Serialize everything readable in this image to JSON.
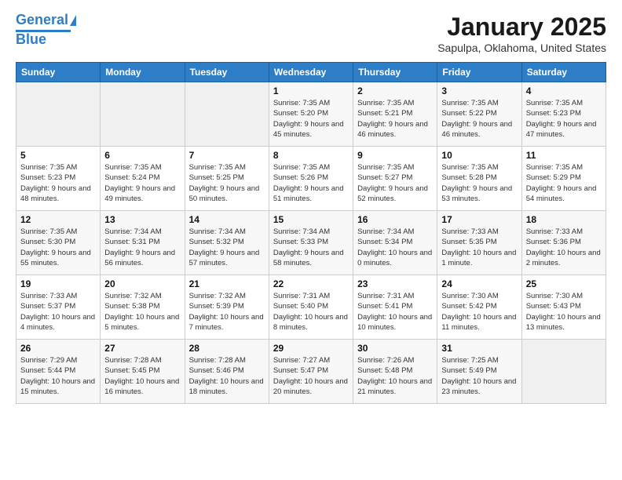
{
  "header": {
    "logo_line1": "General",
    "logo_line2": "Blue",
    "month": "January 2025",
    "location": "Sapulpa, Oklahoma, United States"
  },
  "days_of_week": [
    "Sunday",
    "Monday",
    "Tuesday",
    "Wednesday",
    "Thursday",
    "Friday",
    "Saturday"
  ],
  "weeks": [
    [
      {
        "num": "",
        "info": ""
      },
      {
        "num": "",
        "info": ""
      },
      {
        "num": "",
        "info": ""
      },
      {
        "num": "1",
        "info": "Sunrise: 7:35 AM\nSunset: 5:20 PM\nDaylight: 9 hours and 45 minutes."
      },
      {
        "num": "2",
        "info": "Sunrise: 7:35 AM\nSunset: 5:21 PM\nDaylight: 9 hours and 46 minutes."
      },
      {
        "num": "3",
        "info": "Sunrise: 7:35 AM\nSunset: 5:22 PM\nDaylight: 9 hours and 46 minutes."
      },
      {
        "num": "4",
        "info": "Sunrise: 7:35 AM\nSunset: 5:23 PM\nDaylight: 9 hours and 47 minutes."
      }
    ],
    [
      {
        "num": "5",
        "info": "Sunrise: 7:35 AM\nSunset: 5:23 PM\nDaylight: 9 hours and 48 minutes."
      },
      {
        "num": "6",
        "info": "Sunrise: 7:35 AM\nSunset: 5:24 PM\nDaylight: 9 hours and 49 minutes."
      },
      {
        "num": "7",
        "info": "Sunrise: 7:35 AM\nSunset: 5:25 PM\nDaylight: 9 hours and 50 minutes."
      },
      {
        "num": "8",
        "info": "Sunrise: 7:35 AM\nSunset: 5:26 PM\nDaylight: 9 hours and 51 minutes."
      },
      {
        "num": "9",
        "info": "Sunrise: 7:35 AM\nSunset: 5:27 PM\nDaylight: 9 hours and 52 minutes."
      },
      {
        "num": "10",
        "info": "Sunrise: 7:35 AM\nSunset: 5:28 PM\nDaylight: 9 hours and 53 minutes."
      },
      {
        "num": "11",
        "info": "Sunrise: 7:35 AM\nSunset: 5:29 PM\nDaylight: 9 hours and 54 minutes."
      }
    ],
    [
      {
        "num": "12",
        "info": "Sunrise: 7:35 AM\nSunset: 5:30 PM\nDaylight: 9 hours and 55 minutes."
      },
      {
        "num": "13",
        "info": "Sunrise: 7:34 AM\nSunset: 5:31 PM\nDaylight: 9 hours and 56 minutes."
      },
      {
        "num": "14",
        "info": "Sunrise: 7:34 AM\nSunset: 5:32 PM\nDaylight: 9 hours and 57 minutes."
      },
      {
        "num": "15",
        "info": "Sunrise: 7:34 AM\nSunset: 5:33 PM\nDaylight: 9 hours and 58 minutes."
      },
      {
        "num": "16",
        "info": "Sunrise: 7:34 AM\nSunset: 5:34 PM\nDaylight: 10 hours and 0 minutes."
      },
      {
        "num": "17",
        "info": "Sunrise: 7:33 AM\nSunset: 5:35 PM\nDaylight: 10 hours and 1 minute."
      },
      {
        "num": "18",
        "info": "Sunrise: 7:33 AM\nSunset: 5:36 PM\nDaylight: 10 hours and 2 minutes."
      }
    ],
    [
      {
        "num": "19",
        "info": "Sunrise: 7:33 AM\nSunset: 5:37 PM\nDaylight: 10 hours and 4 minutes."
      },
      {
        "num": "20",
        "info": "Sunrise: 7:32 AM\nSunset: 5:38 PM\nDaylight: 10 hours and 5 minutes."
      },
      {
        "num": "21",
        "info": "Sunrise: 7:32 AM\nSunset: 5:39 PM\nDaylight: 10 hours and 7 minutes."
      },
      {
        "num": "22",
        "info": "Sunrise: 7:31 AM\nSunset: 5:40 PM\nDaylight: 10 hours and 8 minutes."
      },
      {
        "num": "23",
        "info": "Sunrise: 7:31 AM\nSunset: 5:41 PM\nDaylight: 10 hours and 10 minutes."
      },
      {
        "num": "24",
        "info": "Sunrise: 7:30 AM\nSunset: 5:42 PM\nDaylight: 10 hours and 11 minutes."
      },
      {
        "num": "25",
        "info": "Sunrise: 7:30 AM\nSunset: 5:43 PM\nDaylight: 10 hours and 13 minutes."
      }
    ],
    [
      {
        "num": "26",
        "info": "Sunrise: 7:29 AM\nSunset: 5:44 PM\nDaylight: 10 hours and 15 minutes."
      },
      {
        "num": "27",
        "info": "Sunrise: 7:28 AM\nSunset: 5:45 PM\nDaylight: 10 hours and 16 minutes."
      },
      {
        "num": "28",
        "info": "Sunrise: 7:28 AM\nSunset: 5:46 PM\nDaylight: 10 hours and 18 minutes."
      },
      {
        "num": "29",
        "info": "Sunrise: 7:27 AM\nSunset: 5:47 PM\nDaylight: 10 hours and 20 minutes."
      },
      {
        "num": "30",
        "info": "Sunrise: 7:26 AM\nSunset: 5:48 PM\nDaylight: 10 hours and 21 minutes."
      },
      {
        "num": "31",
        "info": "Sunrise: 7:25 AM\nSunset: 5:49 PM\nDaylight: 10 hours and 23 minutes."
      },
      {
        "num": "",
        "info": ""
      }
    ]
  ]
}
